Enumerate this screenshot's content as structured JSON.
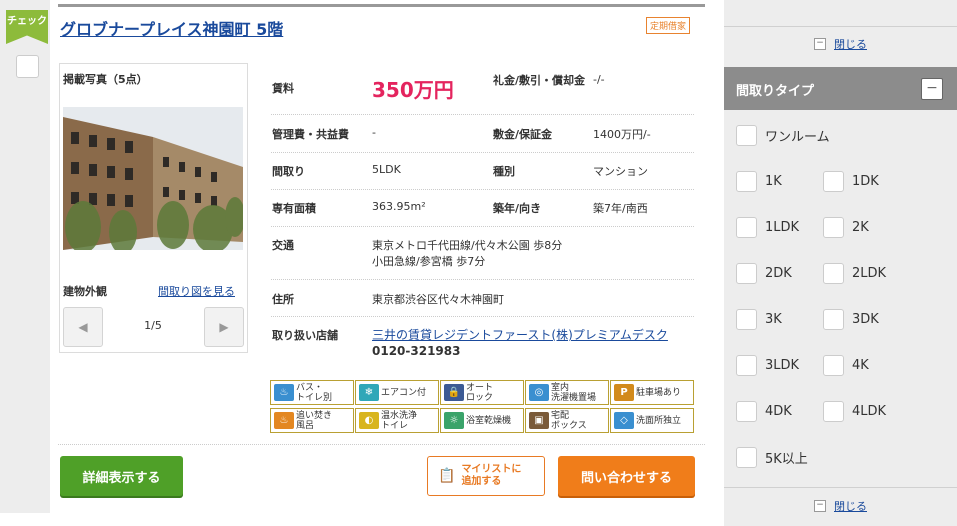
{
  "check_tag": "チェック",
  "listing": {
    "title": "グロブナープレイス神園町 5階",
    "badge": "定期借家",
    "photos": {
      "label": "掲載写真（5点）",
      "caption": "建物外観",
      "floorplan_link": "間取り図を見る",
      "counter": "1/5"
    },
    "specs": {
      "rent_label": "賃料",
      "rent_value": "350万円",
      "deposit_key_label": "礼金/敷引・償却金",
      "deposit_key_value": "-/-",
      "mgmt_label": "管理費・共益費",
      "mgmt_value": "-",
      "shikikin_label": "敷金/保証金",
      "shikikin_value": "1400万円/-",
      "layout_label": "間取り",
      "layout_value": "5LDK",
      "type_label": "種別",
      "type_value": "マンション",
      "area_label": "専有面積",
      "area_value": "363.95m²",
      "age_label": "築年/向き",
      "age_value": "築7年/南西",
      "access_label": "交通",
      "access_line1": "東京メトロ千代田線/代々木公園 歩8分",
      "access_line2": "小田急線/参宮橋 歩7分",
      "address_label": "住所",
      "address_value": "東京都渋谷区代々木神園町",
      "agent_label": "取り扱い店舗",
      "agent_name": "三井の賃貸レジデントファースト(株)プレミアムデスク",
      "agent_phone": "0120-321983"
    },
    "features": [
      {
        "line1": "バス・",
        "line2": "トイレ別",
        "icon": "bath-icon",
        "color": "#3a8fd0"
      },
      {
        "line1": "エアコン付",
        "line2": "",
        "icon": "aircon-icon",
        "color": "#2fa7b8"
      },
      {
        "line1": "オート",
        "line2": "ロック",
        "icon": "autolock-icon",
        "color": "#3c5a94"
      },
      {
        "line1": "室内",
        "line2": "洗濯機置場",
        "icon": "washer-icon",
        "color": "#3a8fd0"
      },
      {
        "line1": "駐車場あり",
        "line2": "",
        "icon": "parking-icon",
        "color": "#d28a1b"
      },
      {
        "line1": "追い焚き",
        "line2": "風呂",
        "icon": "reheat-bath-icon",
        "color": "#e38722"
      },
      {
        "line1": "温水洗浄",
        "line2": "トイレ",
        "icon": "washlet-icon",
        "color": "#d8b51f"
      },
      {
        "line1": "浴室乾燥機",
        "line2": "",
        "icon": "bath-dryer-icon",
        "color": "#3aa36a"
      },
      {
        "line1": "宅配",
        "line2": "ボックス",
        "icon": "delivery-box-icon",
        "color": "#7a5a3a"
      },
      {
        "line1": "洗面所独立",
        "line2": "",
        "icon": "washroom-icon",
        "color": "#3a8fd0"
      }
    ],
    "buttons": {
      "detail": "詳細表示する",
      "mylist_line1": "マイリストに",
      "mylist_line2": "追加する",
      "inquiry": "問い合わせする"
    }
  },
  "filter_panel": {
    "close_label": "閉じる",
    "header": "間取りタイプ",
    "options": [
      "ワンルーム",
      "1K",
      "1DK",
      "1LDK",
      "2K",
      "2DK",
      "2LDK",
      "3K",
      "3DK",
      "3LDK",
      "4K",
      "4DK",
      "4LDK",
      "5K以上"
    ]
  }
}
